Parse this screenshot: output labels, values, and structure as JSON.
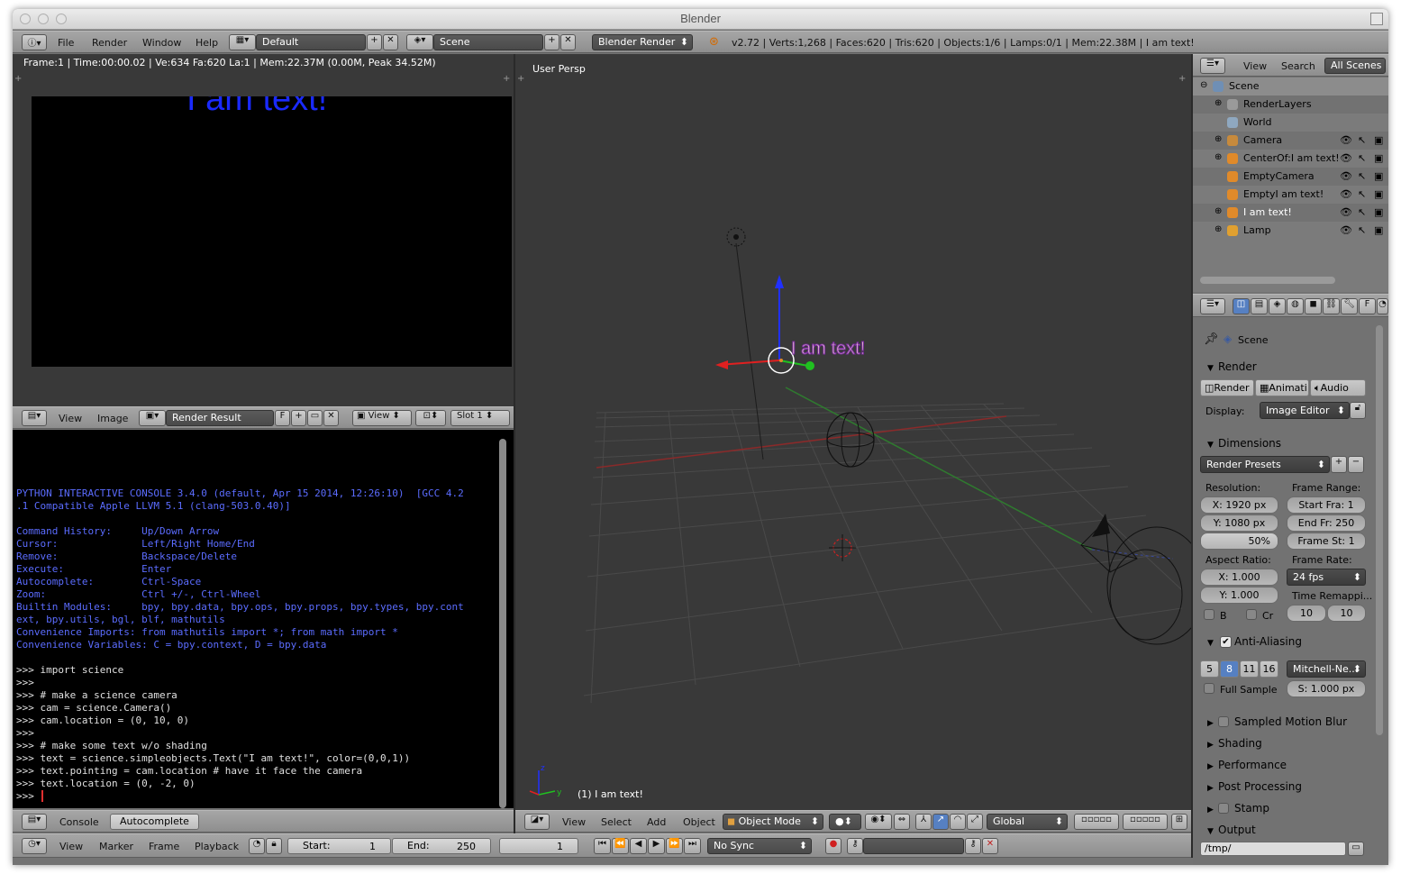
{
  "window": {
    "title": "Blender"
  },
  "top_menu": {
    "items": [
      "File",
      "Render",
      "Window",
      "Help"
    ],
    "layout": "Default",
    "scene": "Scene",
    "engine": "Blender Render",
    "stats": "v2.72 | Verts:1,268 | Faces:620 | Tris:620 | Objects:1/6 | Lamps:0/1 | Mem:22.38M | I am text!"
  },
  "image_editor": {
    "info": "Frame:1 | Time:00:00.02 | Ve:634 Fa:620 La:1 | Mem:22.37M (0.00M, Peak 34.52M)",
    "render_text": "I am text!",
    "header": {
      "view": "View",
      "image": "Image",
      "image_name": "Render Result",
      "fake_user": "F",
      "view_dropdown": "View",
      "slot": "Slot 1"
    }
  },
  "console": {
    "banner": [
      "PYTHON INTERACTIVE CONSOLE 3.4.0 (default, Apr 15 2014, 12:26:10)  [GCC 4.2",
      ".1 Compatible Apple LLVM 5.1 (clang-503.0.40)]",
      "",
      "Command History:     Up/Down Arrow",
      "Cursor:              Left/Right Home/End",
      "Remove:              Backspace/Delete",
      "Execute:             Enter",
      "Autocomplete:        Ctrl-Space",
      "Zoom:                Ctrl +/-, Ctrl-Wheel",
      "Builtin Modules:     bpy, bpy.data, bpy.ops, bpy.props, bpy.types, bpy.cont",
      "ext, bpy.utils, bgl, blf, mathutils",
      "Convenience Imports: from mathutils import *; from math import *",
      "Convenience Variables: C = bpy.context, D = bpy.data"
    ],
    "history": [
      ">>> import science",
      ">>>",
      ">>> # make a science camera",
      ">>> cam = science.Camera()",
      ">>> cam.location = (0, 10, 0)",
      ">>>",
      ">>> # make some text w/o shading",
      ">>> text = science.simpleobjects.Text(\"I am text!\", color=(0,0,1))",
      ">>> text.pointing = cam.location # have it face the camera",
      ">>> text.location = (0, -2, 0)",
      ">>> "
    ],
    "footer": {
      "console": "Console",
      "autocomplete": "Autocomplete"
    }
  },
  "viewport": {
    "label": "User Persp",
    "object_label": "(1) I am text!",
    "scene_text": "I am text!",
    "header": {
      "menus": [
        "View",
        "Select",
        "Add",
        "Object"
      ],
      "mode": "Object Mode",
      "orientation": "Global"
    }
  },
  "timeline": {
    "menus": [
      "View",
      "Marker",
      "Frame",
      "Playback"
    ],
    "start_label": "Start:",
    "start": "1",
    "end_label": "End:",
    "end": "250",
    "current": "1",
    "sync": "No Sync"
  },
  "outliner": {
    "tabs": [
      "View",
      "Search",
      "All Scenes"
    ],
    "items": [
      {
        "name": "Scene",
        "icon_color": "#6f8fb5"
      },
      {
        "name": "RenderLayers",
        "icon_color": "#9a9a9a"
      },
      {
        "name": "World",
        "icon_color": "#8fa8c0"
      },
      {
        "name": "Camera",
        "icon_color": "#c78a3c"
      },
      {
        "name": "CenterOf:I am text!",
        "icon_color": "#e08a2a"
      },
      {
        "name": "EmptyCamera",
        "icon_color": "#e08a2a"
      },
      {
        "name": "EmptyI am text!",
        "icon_color": "#e08a2a"
      },
      {
        "name": "I am text!",
        "icon_color": "#e08a2a"
      },
      {
        "name": "Lamp",
        "icon_color": "#e0a030"
      }
    ]
  },
  "properties": {
    "context": "Scene",
    "render": {
      "title": "Render",
      "buttons": [
        "Render",
        "Animati",
        "Audio"
      ],
      "display_label": "Display:",
      "display": "Image Editor"
    },
    "dimensions": {
      "title": "Dimensions",
      "presets": "Render Presets",
      "resolution_label": "Resolution:",
      "res_x": "X: 1920 px",
      "res_y": "Y: 1080 px",
      "res_pct": "50%",
      "frame_range_label": "Frame Range:",
      "start_frame": "Start Fra: 1",
      "end_frame": "End Fr: 250",
      "frame_step": "Frame St: 1",
      "aspect_label": "Aspect Ratio:",
      "aspect_x": "X:     1.000",
      "aspect_y": "Y:     1.000",
      "frame_rate_label": "Frame Rate:",
      "fps": "24 fps",
      "time_remap_label": "Time Remappi...",
      "remap_old": "10",
      "remap_new": "10",
      "border": "B",
      "crop": "Cr"
    },
    "anti_aliasing": {
      "title": "Anti-Aliasing",
      "samples": [
        "5",
        "8",
        "11",
        "16"
      ],
      "filter": "Mitchell-Ne...",
      "full_sample": "Full Sample",
      "size": "S: 1.000 px"
    },
    "sections": [
      "Sampled Motion Blur",
      "Shading",
      "Performance",
      "Post Processing",
      "Stamp",
      "Output"
    ],
    "output_path": "/tmp/"
  },
  "colors": {
    "blender_gray": "#737373",
    "viewport_bg": "#393939",
    "console_text": "#5b6cff",
    "console_bg": "#000000",
    "text_blue": "#1a2aff",
    "accent_blue": "#5680c2"
  }
}
